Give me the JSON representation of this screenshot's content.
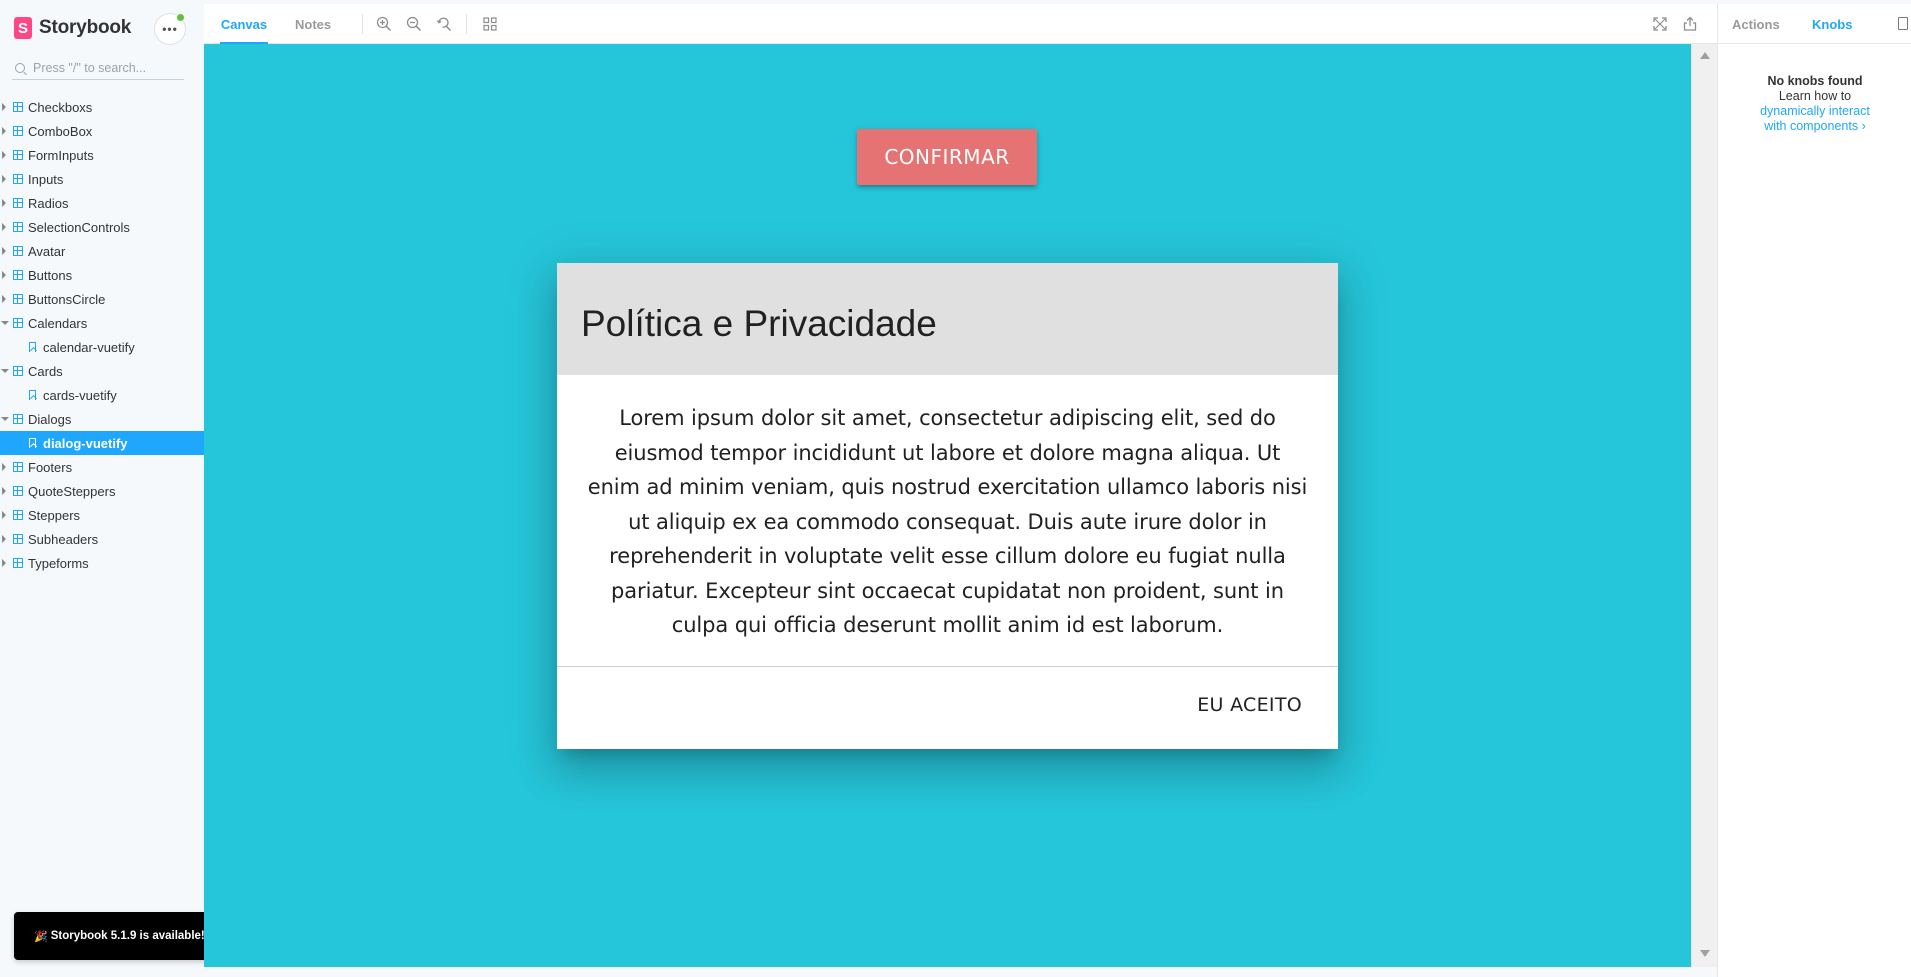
{
  "brand": {
    "name": "Storybook",
    "logo_letter": "S",
    "color": "#ff4785"
  },
  "sidebar": {
    "menu_label": "•••",
    "search_placeholder": "Press \"/\" to search...",
    "items": [
      {
        "label": "Checkboxs",
        "type": "component",
        "expanded": false
      },
      {
        "label": "ComboBox",
        "type": "component",
        "expanded": false
      },
      {
        "label": "FormInputs",
        "type": "component",
        "expanded": false
      },
      {
        "label": "Inputs",
        "type": "component",
        "expanded": false
      },
      {
        "label": "Radios",
        "type": "component",
        "expanded": false
      },
      {
        "label": "SelectionControls",
        "type": "component",
        "expanded": false
      },
      {
        "label": "Avatar",
        "type": "component",
        "expanded": false
      },
      {
        "label": "Buttons",
        "type": "component",
        "expanded": false
      },
      {
        "label": "ButtonsCircle",
        "type": "component",
        "expanded": false
      },
      {
        "label": "Calendars",
        "type": "component",
        "expanded": true
      },
      {
        "label": "calendar-vuetify",
        "type": "story",
        "active": false
      },
      {
        "label": "Cards",
        "type": "component",
        "expanded": true
      },
      {
        "label": "cards-vuetify",
        "type": "story",
        "active": false
      },
      {
        "label": "Dialogs",
        "type": "component",
        "expanded": true
      },
      {
        "label": "dialog-vuetify",
        "type": "story",
        "active": true
      },
      {
        "label": "Footers",
        "type": "component",
        "expanded": false
      },
      {
        "label": "QuoteSteppers",
        "type": "component",
        "expanded": false
      },
      {
        "label": "Steppers",
        "type": "component",
        "expanded": false
      },
      {
        "label": "Subheaders",
        "type": "component",
        "expanded": false
      },
      {
        "label": "Typeforms",
        "type": "component",
        "expanded": false
      }
    ],
    "update_notice": {
      "icon": "party-popper-icon",
      "text": "Storybook 5.1.9 is available!"
    }
  },
  "toolbar": {
    "tabs": [
      "Canvas",
      "Notes"
    ],
    "active_tab": "Canvas",
    "tools": [
      "zoom-in-icon",
      "zoom-out-icon",
      "zoom-reset-icon",
      "grid-icon"
    ],
    "right_tools": [
      "fullscreen-icon",
      "share-icon"
    ]
  },
  "canvas": {
    "background": "#26c6da",
    "confirm_button": "CONFIRMAR",
    "confirm_color": "#e57373",
    "dialog": {
      "title": "Política e Privacidade",
      "body": "Lorem ipsum dolor sit amet, consectetur adipiscing elit, sed do eiusmod tempor incididunt ut labore et dolore magna aliqua. Ut enim ad minim veniam, quis nostrud exercitation ullamco laboris nisi ut aliquip ex ea commodo consequat. Duis aute irure dolor in reprehenderit in voluptate velit esse cillum dolore eu fugiat nulla pariatur. Excepteur sint occaecat cupidatat non proident, sunt in culpa qui officia deserunt mollit anim id est laborum.",
      "action": "EU ACEITO"
    }
  },
  "addons": {
    "tabs": [
      "Actions",
      "Knobs"
    ],
    "active_tab": "Knobs",
    "empty_title": "No knobs found",
    "empty_text": "Learn how to",
    "link_text": "dynamically interact with components",
    "link_chevron": "›"
  },
  "accent": "#1ea7fd"
}
